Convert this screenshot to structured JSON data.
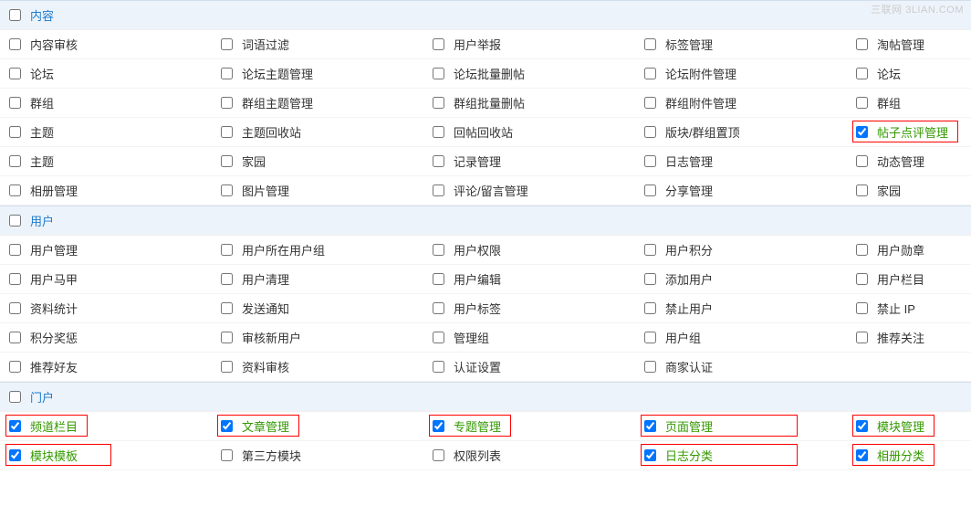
{
  "watermark": "三联网 3LIAN.COM",
  "sections": [
    {
      "key": "content",
      "title": "内容",
      "checked": false,
      "rows": [
        [
          {
            "label": "内容审核",
            "checked": false
          },
          {
            "label": "词语过滤",
            "checked": false
          },
          {
            "label": "用户举报",
            "checked": false
          },
          {
            "label": "标签管理",
            "checked": false
          },
          {
            "label": "淘帖管理",
            "checked": false
          }
        ],
        [
          {
            "label": "论坛",
            "checked": false
          },
          {
            "label": "论坛主题管理",
            "checked": false
          },
          {
            "label": "论坛批量删帖",
            "checked": false
          },
          {
            "label": "论坛附件管理",
            "checked": false
          },
          {
            "label": "论坛",
            "checked": false
          }
        ],
        [
          {
            "label": "群组",
            "checked": false
          },
          {
            "label": "群组主题管理",
            "checked": false
          },
          {
            "label": "群组批量删帖",
            "checked": false
          },
          {
            "label": "群组附件管理",
            "checked": false
          },
          {
            "label": "群组",
            "checked": false
          }
        ],
        [
          {
            "label": "主题",
            "checked": false
          },
          {
            "label": "主题回收站",
            "checked": false
          },
          {
            "label": "回帖回收站",
            "checked": false
          },
          {
            "label": "版块/群组置顶",
            "checked": false
          },
          {
            "label": "帖子点评管理",
            "checked": true,
            "highlight": true
          }
        ],
        [
          {
            "label": "主题",
            "checked": false
          },
          {
            "label": "家园",
            "checked": false
          },
          {
            "label": "记录管理",
            "checked": false
          },
          {
            "label": "日志管理",
            "checked": false
          },
          {
            "label": "动态管理",
            "checked": false
          }
        ],
        [
          {
            "label": "相册管理",
            "checked": false
          },
          {
            "label": "图片管理",
            "checked": false
          },
          {
            "label": "评论/留言管理",
            "checked": false
          },
          {
            "label": "分享管理",
            "checked": false
          },
          {
            "label": "家园",
            "checked": false
          }
        ]
      ]
    },
    {
      "key": "user",
      "title": "用户",
      "checked": false,
      "rows": [
        [
          {
            "label": "用户管理",
            "checked": false
          },
          {
            "label": "用户所在用户组",
            "checked": false
          },
          {
            "label": "用户权限",
            "checked": false
          },
          {
            "label": "用户积分",
            "checked": false
          },
          {
            "label": "用户勋章",
            "checked": false
          }
        ],
        [
          {
            "label": "用户马甲",
            "checked": false
          },
          {
            "label": "用户清理",
            "checked": false
          },
          {
            "label": "用户编辑",
            "checked": false
          },
          {
            "label": "添加用户",
            "checked": false
          },
          {
            "label": "用户栏目",
            "checked": false
          }
        ],
        [
          {
            "label": "资料统计",
            "checked": false
          },
          {
            "label": "发送通知",
            "checked": false
          },
          {
            "label": "用户标签",
            "checked": false
          },
          {
            "label": "禁止用户",
            "checked": false
          },
          {
            "label": "禁止 IP",
            "checked": false
          }
        ],
        [
          {
            "label": "积分奖惩",
            "checked": false
          },
          {
            "label": "审核新用户",
            "checked": false
          },
          {
            "label": "管理组",
            "checked": false
          },
          {
            "label": "用户组",
            "checked": false
          },
          {
            "label": "推荐关注",
            "checked": false
          }
        ],
        [
          {
            "label": "推荐好友",
            "checked": false
          },
          {
            "label": "资料审核",
            "checked": false
          },
          {
            "label": "认证设置",
            "checked": false
          },
          {
            "label": "商家认证",
            "checked": false
          },
          {
            "label": "",
            "checked": null
          }
        ]
      ]
    },
    {
      "key": "portal",
      "title": "门户",
      "checked": false,
      "rows": [
        [
          {
            "label": "频道栏目",
            "checked": true,
            "highlight": true
          },
          {
            "label": "文章管理",
            "checked": true,
            "highlight": true
          },
          {
            "label": "专题管理",
            "checked": true,
            "highlight": true
          },
          {
            "label": "页面管理",
            "checked": true,
            "highlight": true
          },
          {
            "label": "模块管理",
            "checked": true,
            "highlight": true
          }
        ],
        [
          {
            "label": "模块模板",
            "checked": true,
            "highlight": true
          },
          {
            "label": "第三方模块",
            "checked": false
          },
          {
            "label": "权限列表",
            "checked": false
          },
          {
            "label": "日志分类",
            "checked": true,
            "highlight": true
          },
          {
            "label": "相册分类",
            "checked": true,
            "highlight": true
          }
        ]
      ]
    }
  ]
}
